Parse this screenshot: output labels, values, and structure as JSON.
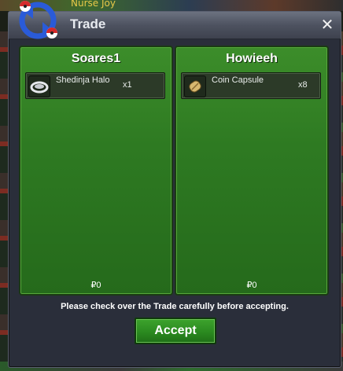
{
  "window": {
    "title": "Trade",
    "close_label": "✕"
  },
  "backdrop": {
    "player_name_fragment": "Nurse Joy"
  },
  "left_panel": {
    "player": "Soares1",
    "items": [
      {
        "name": "Shedinja Halo",
        "qty": "x1",
        "icon": "halo-icon"
      }
    ],
    "money": "₽0"
  },
  "right_panel": {
    "player": "Howieeh",
    "items": [
      {
        "name": "Coin Capsule",
        "qty": "x8",
        "icon": "coin-capsule-icon"
      }
    ],
    "money": "₽0"
  },
  "notice": "Please check over the Trade carefully before accepting.",
  "accept_label": "Accept",
  "colors": {
    "panel_green": "#2e7a22",
    "window_bg": "#2a2e3a",
    "button_green": "#2b8a20"
  }
}
